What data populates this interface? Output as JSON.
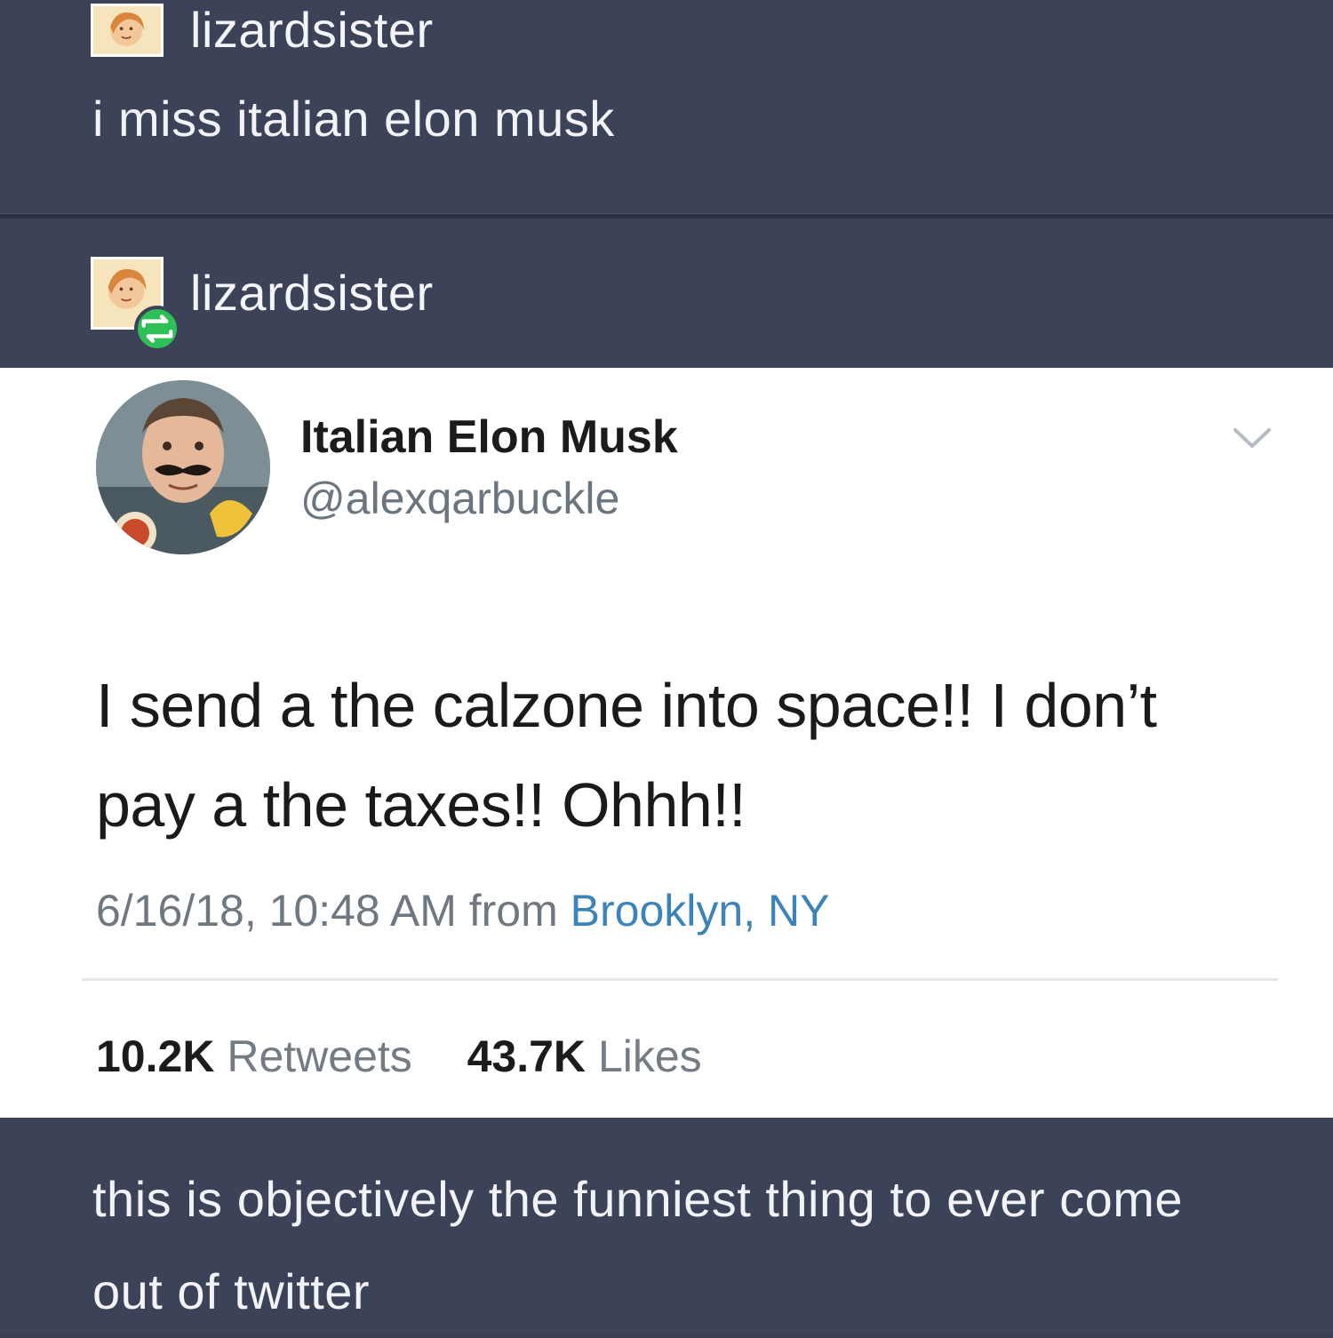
{
  "posts": {
    "original": {
      "username": "lizardsister",
      "text": "i miss italian elon musk"
    },
    "reblog": {
      "username": "lizardsister"
    },
    "comment": {
      "text": "this is objectively the funniest thing to ever come out of twitter"
    }
  },
  "tweet": {
    "display_name": "Italian Elon Musk",
    "handle": "@alexqarbuckle",
    "body": "I send a the calzone into space!! I don’t pay a the taxes!! Ohhh!!",
    "timestamp": "6/16/18, 10:48 AM from",
    "location": "Brooklyn, NY",
    "retweets_count": "10.2K",
    "retweets_label": "Retweets",
    "likes_count": "43.7K",
    "likes_label": "Likes"
  },
  "colors": {
    "tumblr_bg": "#3c4359",
    "reblog_badge": "#2fbf57",
    "link": "#3b83b8"
  },
  "icons": {
    "reblog": "reblog-icon",
    "menu": "chevron-down-icon"
  }
}
